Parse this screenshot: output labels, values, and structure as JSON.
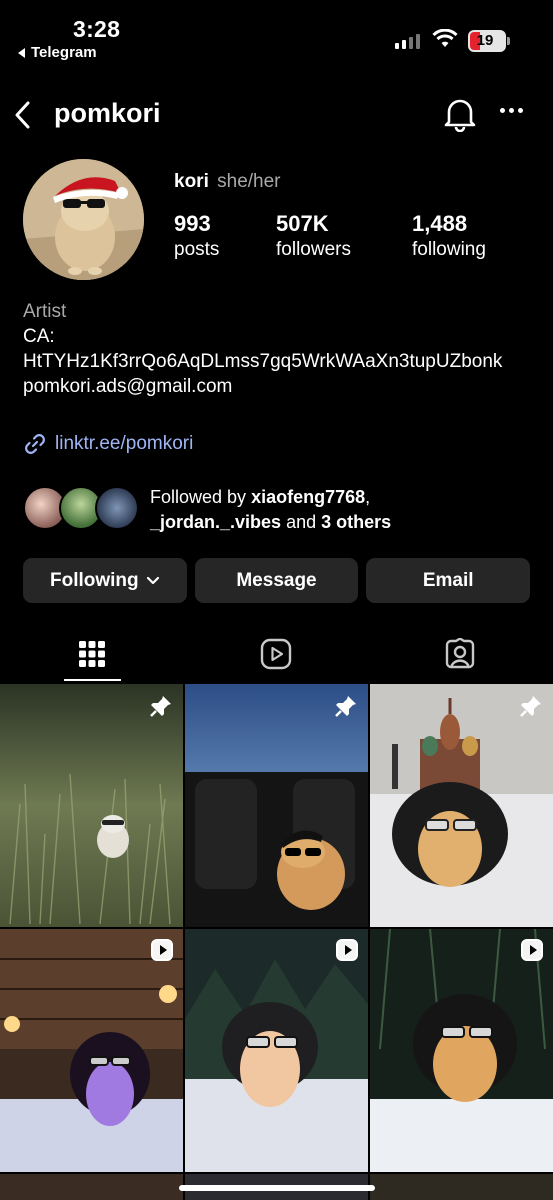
{
  "status_bar": {
    "time": "3:28",
    "back_app": "Telegram",
    "battery": "19"
  },
  "header": {
    "username": "pomkori"
  },
  "profile": {
    "name": "kori",
    "pronouns": "she/her",
    "stats": [
      {
        "value": "993",
        "label": "posts"
      },
      {
        "value": "507K",
        "label": "followers"
      },
      {
        "value": "1,488",
        "label": "following"
      }
    ],
    "bio": {
      "category": "Artist",
      "line1": "CA:",
      "line2": "HtTYHz1Kf3rrQo6AqDLmss7gq5WrkWAaXn3tupUZbonk",
      "line3": "pomkori.ads@gmail.com"
    },
    "link": "linktr.ee/pomkori"
  },
  "followed_by": {
    "prefix": "Followed by ",
    "user1": "xiaofeng7768",
    "sep": ",",
    "user2": "_jordan._.vibes",
    "mid": " and ",
    "others": "3 others"
  },
  "buttons": {
    "following": "Following",
    "message": "Message",
    "email": "Email"
  },
  "tabs": [
    {
      "icon": "grid-icon",
      "active": true
    },
    {
      "icon": "reels-icon",
      "active": false
    },
    {
      "icon": "tagged-icon",
      "active": false
    }
  ],
  "posts": [
    {
      "kind": "pinned",
      "scene": "dog in grass at night"
    },
    {
      "kind": "pinned",
      "scene": "dog in car with cap"
    },
    {
      "kind": "pinned",
      "scene": "dog in fur hat at Red Square"
    },
    {
      "kind": "reel",
      "scene": "dog in fur hat at night lodge"
    },
    {
      "kind": "reel",
      "scene": "dog in fur hat in snow"
    },
    {
      "kind": "reel",
      "scene": "dog in fur hat in snowy forest"
    }
  ],
  "colors": {
    "background": "#000000",
    "button": "#262626",
    "link": "#a0b5f5",
    "secondary_text": "#a8a8a8"
  }
}
